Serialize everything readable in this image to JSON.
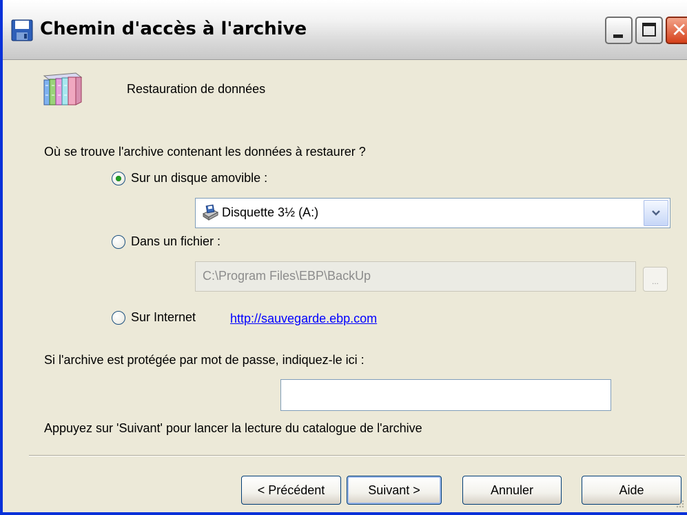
{
  "window": {
    "title": "Chemin d'accès à l'archive",
    "controls": {
      "minimize": "minimize",
      "maximize": "maximize",
      "close": "close"
    }
  },
  "header": {
    "icon": "books-archive-icon",
    "text": "Restauration de données"
  },
  "question": "Où se trouve l'archive contenant les données à restaurer ?",
  "options": {
    "removable": {
      "label": "Sur un disque amovible  :",
      "checked": true,
      "drive_value": "Disquette 3½ (A:)",
      "drive_icon": "floppy-drive-icon"
    },
    "file": {
      "label": "Dans un fichier :",
      "checked": false,
      "path_value": "C:\\Program Files\\EBP\\BackUp",
      "browse_label": "..."
    },
    "internet": {
      "label": "Sur Internet",
      "checked": false,
      "link": "http://sauvegarde.ebp.com"
    }
  },
  "password": {
    "label": "Si l'archive est protégée par mot de passe, indiquez-le ici :",
    "value": ""
  },
  "info": "Appuyez sur 'Suivant' pour lancer la lecture du catalogue de l'archive",
  "buttons": {
    "previous": "< Précédent",
    "next": "Suivant >",
    "cancel": "Annuler",
    "help": "Aide"
  },
  "colors": {
    "face": "#ECE9D8",
    "link": "#0000FF",
    "radio_dot": "#21A121",
    "frame_border": "#0831D9"
  }
}
